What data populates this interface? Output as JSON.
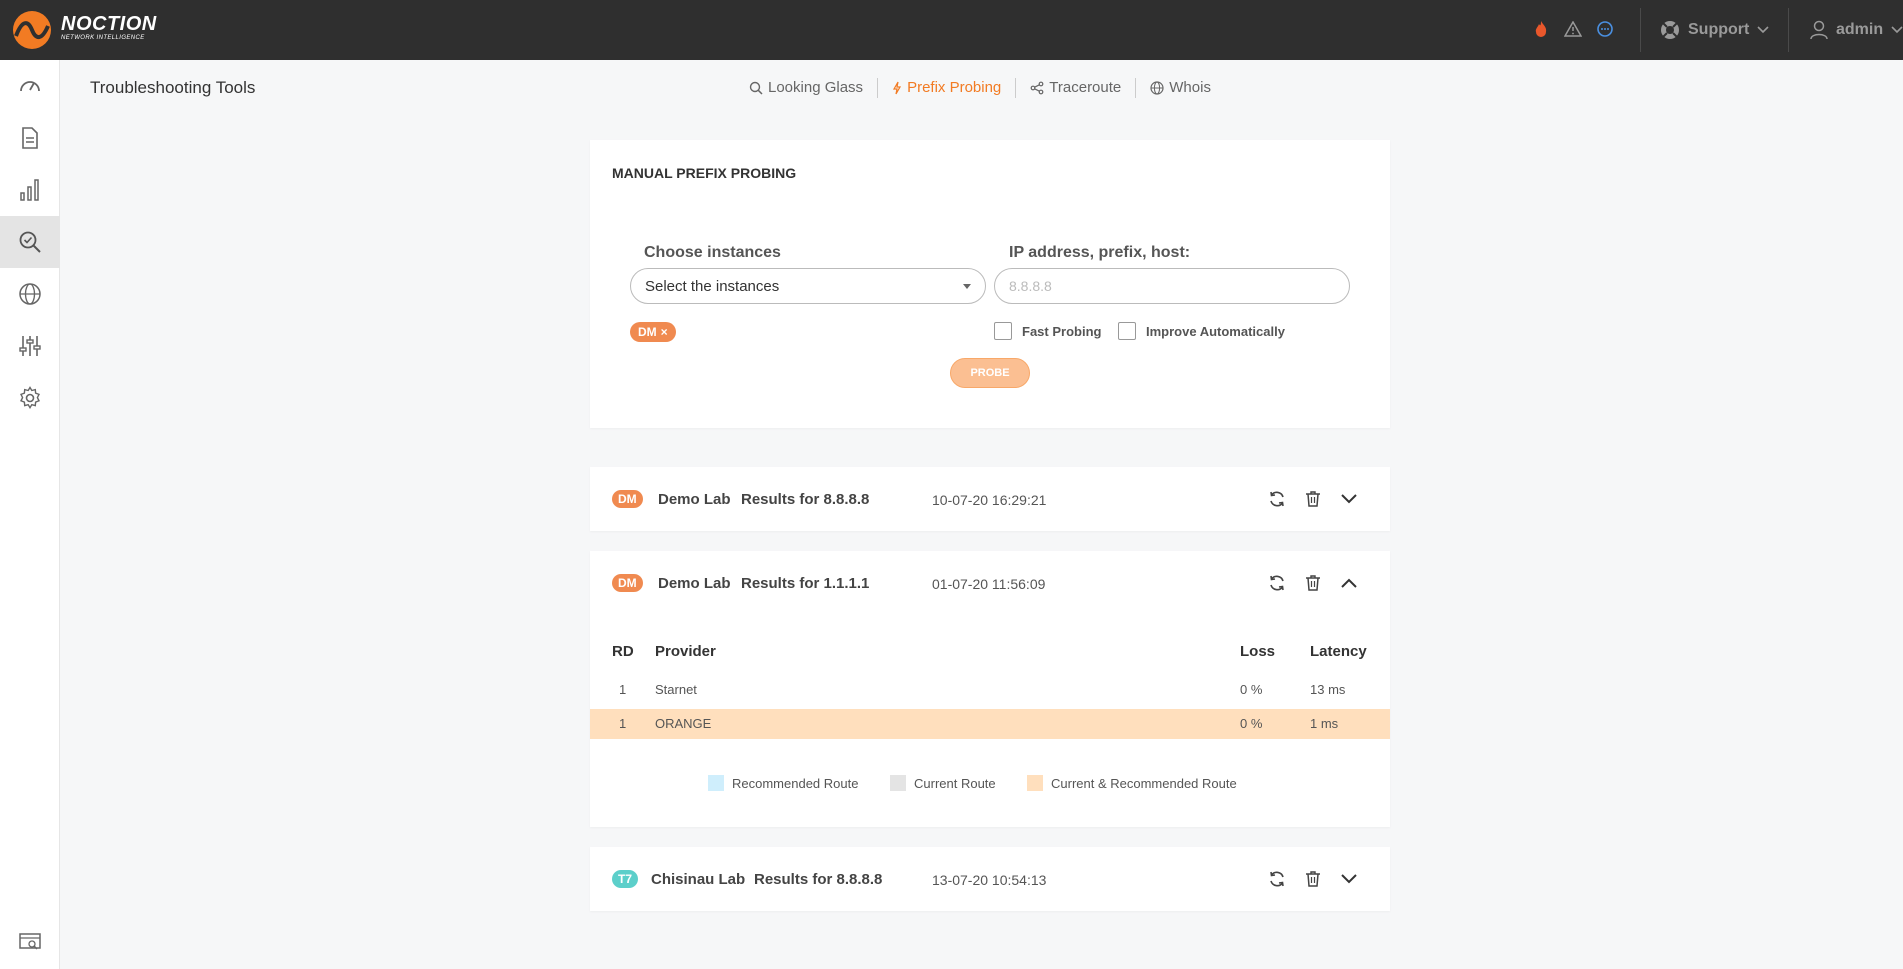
{
  "brand": {
    "name": "NOCTION",
    "tagline": "NETWORK INTELLIGENCE"
  },
  "topbar": {
    "icons": [
      "fire-icon",
      "warning-icon",
      "chat-icon"
    ],
    "support_label": "Support",
    "user_label": "admin"
  },
  "sidebar": {
    "items": [
      "dashboard-icon",
      "reports-icon",
      "charts-icon",
      "troubleshooting-icon",
      "globe-icon",
      "sliders-icon",
      "settings-icon"
    ],
    "active_index": 3,
    "bottom_item": "screen-search-icon"
  },
  "page": {
    "title": "Troubleshooting Tools"
  },
  "tabs": [
    {
      "label": "Looking Glass",
      "icon": "search-icon",
      "active": false
    },
    {
      "label": "Prefix Probing",
      "icon": "bolt-icon",
      "active": true
    },
    {
      "label": "Traceroute",
      "icon": "share-icon",
      "active": false
    },
    {
      "label": "Whois",
      "icon": "globe-icon",
      "active": false
    }
  ],
  "probing": {
    "title": "MANUAL PREFIX PROBING",
    "instances_label": "Choose instances",
    "instances_value": "Select the instances",
    "ip_label": "IP address, prefix, host:",
    "ip_placeholder": "8.8.8.8",
    "selected_chip": "DM",
    "chip_remove": "×",
    "fast_probing_label": "Fast Probing",
    "improve_label": "Improve Automatically",
    "probe_button": "PROBE"
  },
  "results": [
    {
      "badge": "DM",
      "lab": "Demo Lab",
      "result": "Results for 8.8.8.8",
      "date": "10-07-20 16:29:21",
      "expanded": false
    },
    {
      "badge": "DM",
      "lab": "Demo Lab",
      "result": "Results for 1.1.1.1",
      "date": "01-07-20 11:56:09",
      "expanded": true,
      "table": {
        "headers": {
          "rd": "RD",
          "provider": "Provider",
          "loss": "Loss",
          "latency": "Latency"
        },
        "rows": [
          {
            "rd": "1",
            "provider": "Starnet",
            "loss": "0 %",
            "latency": "13 ms",
            "highlight": false
          },
          {
            "rd": "1",
            "provider": "ORANGE",
            "loss": "0 %",
            "latency": "1 ms",
            "highlight": true
          }
        ]
      },
      "legend": [
        {
          "label": "Recommended Route",
          "color": "#cfeefc"
        },
        {
          "label": "Current Route",
          "color": "#e4e4e4"
        },
        {
          "label": "Current & Recommended Route",
          "color": "#ffdfbd"
        }
      ]
    },
    {
      "badge": "T7",
      "lab": "Chisinau Lab",
      "result": "Results for 8.8.8.8",
      "date": "13-07-20 10:54:13",
      "expanded": false
    }
  ],
  "colors": {
    "accent": "#f27b23",
    "dm_badge": "#f08a50",
    "t7_badge": "#5ccfca",
    "highlight_row": "#ffdfbd"
  }
}
